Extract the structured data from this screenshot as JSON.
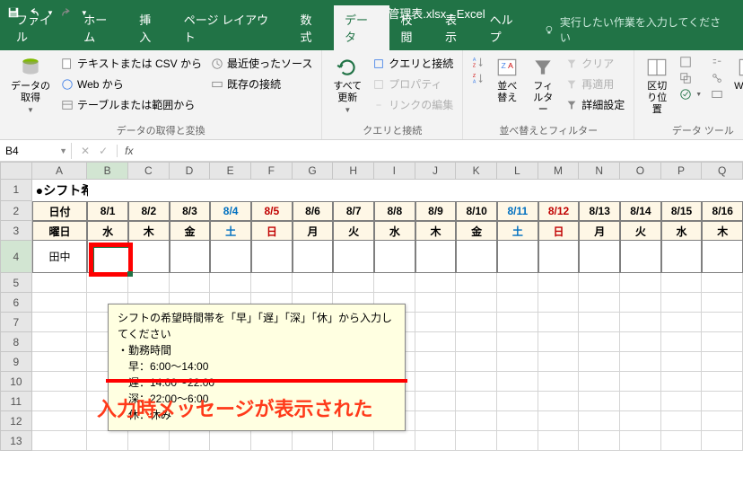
{
  "app_title": "シフト管理表.xlsx - Excel",
  "tabs": {
    "file": "ファイル",
    "home": "ホーム",
    "insert": "挿入",
    "layout": "ページ レイアウト",
    "formulas": "数式",
    "data": "データ",
    "review": "校閲",
    "view": "表示",
    "help": "ヘルプ",
    "tell_me": "実行したい作業を入力してください"
  },
  "ribbon": {
    "external": {
      "main": "データの\n取得",
      "csv": "テキストまたは CSV から",
      "web": "Web から",
      "table": "テーブルまたは範囲から",
      "recent": "最近使ったソース",
      "existing": "既存の接続",
      "label": "データの取得と変換"
    },
    "queries": {
      "refresh": "すべて\n更新",
      "conns": "クエリと接続",
      "props": "プロパティ",
      "links": "リンクの編集",
      "label": "クエリと接続"
    },
    "sort": {
      "asc_icon": "A→Z",
      "desc_icon": "Z→A",
      "sort": "並べ替え",
      "filter": "フィルター",
      "clear": "クリア",
      "reapply": "再適用",
      "advanced": "詳細設定",
      "label": "並べ替えとフィルター"
    },
    "tools": {
      "text_cols": "区切り位置",
      "whatif": "What-I",
      "label": "データ ツール"
    }
  },
  "namebox": "B4",
  "fx_label": "fx",
  "sheet": {
    "title": "●シフト希望表",
    "row_labels": {
      "date": "日付",
      "day": "曜日"
    },
    "cols": [
      "A",
      "B",
      "C",
      "D",
      "E",
      "F",
      "G",
      "H",
      "I",
      "J",
      "K",
      "L",
      "M",
      "N",
      "O",
      "P",
      "Q"
    ],
    "dates": [
      "8/1",
      "8/2",
      "8/3",
      "8/4",
      "8/5",
      "8/6",
      "8/7",
      "8/8",
      "8/9",
      "8/10",
      "8/11",
      "8/12",
      "8/13",
      "8/14",
      "8/15",
      "8/16"
    ],
    "days": [
      "水",
      "木",
      "金",
      "土",
      "日",
      "月",
      "火",
      "水",
      "木",
      "金",
      "土",
      "日",
      "月",
      "火",
      "水",
      "木"
    ],
    "day_class": [
      "",
      "",
      "",
      "sat",
      "sun",
      "",
      "",
      "",
      "",
      "",
      "sat",
      "sun",
      "",
      "",
      "",
      ""
    ],
    "name1": "田中"
  },
  "input_message": {
    "l1": "シフトの希望時間帯を「早」「遅」「深」「休」から入力してください",
    "l2": "・勤務時間",
    "l3": "　早：6:00～14:00",
    "l4": "　遅：14:00～22:00",
    "l5": "　深：22:00～6:00",
    "l6": "　休：休み"
  },
  "annotation": "入力時メッセージが表示された"
}
